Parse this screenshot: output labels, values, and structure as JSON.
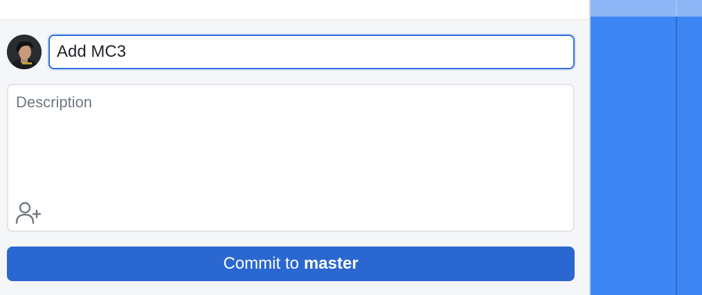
{
  "commit": {
    "summary_value": "Add MC3",
    "description_placeholder": "Description",
    "button_prefix": "Commit to",
    "branch": "master",
    "co_author_icon": "person-add-icon",
    "avatar_icon": "user-avatar"
  },
  "colors": {
    "accent": "#2a67d0",
    "focus_border": "#2f6fe0",
    "right_pane": "#3d86f4",
    "right_pane_header": "#8db6f7"
  }
}
